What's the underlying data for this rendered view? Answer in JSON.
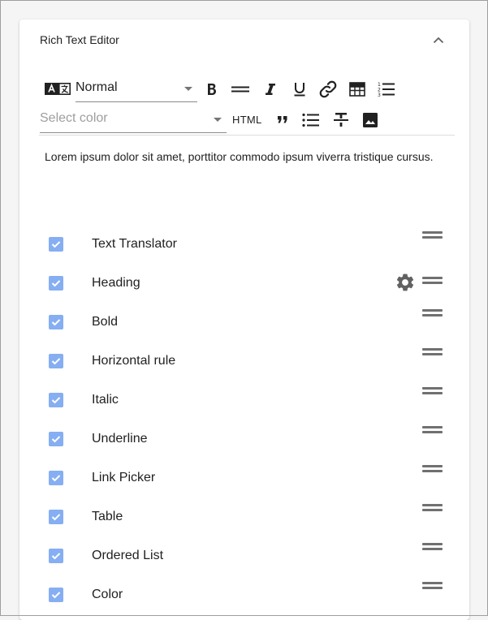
{
  "panel": {
    "title": "Rich Text Editor",
    "collapse_icon": "chevron-up-icon"
  },
  "toolbar": {
    "translator_icon": "text-translator-icon",
    "heading_select": {
      "value": "Normal"
    },
    "color_select": {
      "placeholder": "Select color"
    },
    "html_label": "HTML",
    "icons": [
      "bold-icon",
      "horizontal-rule-icon",
      "italic-icon",
      "underline-icon",
      "link-icon",
      "table-icon",
      "ordered-list-icon",
      "quote-icon",
      "bullet-list-icon",
      "strikethrough-icon",
      "image-icon"
    ]
  },
  "editor": {
    "content": "Lorem ipsum dolor sit amet, porttitor commodo ipsum viverra tristique cursus."
  },
  "features": [
    {
      "label": "Text Translator",
      "checked": true
    },
    {
      "label": "Heading",
      "checked": true,
      "settings": true
    },
    {
      "label": "Bold",
      "checked": true
    },
    {
      "label": "Horizontal rule",
      "checked": true
    },
    {
      "label": "Italic",
      "checked": true
    },
    {
      "label": "Underline",
      "checked": true
    },
    {
      "label": "Link Picker",
      "checked": true
    },
    {
      "label": "Table",
      "checked": true
    },
    {
      "label": "Ordered List",
      "checked": true
    },
    {
      "label": "Color",
      "checked": true
    }
  ],
  "colors": {
    "checkbox": "#86aef2",
    "icon": "#212121",
    "handle": "#707070",
    "gear": "#616161"
  }
}
